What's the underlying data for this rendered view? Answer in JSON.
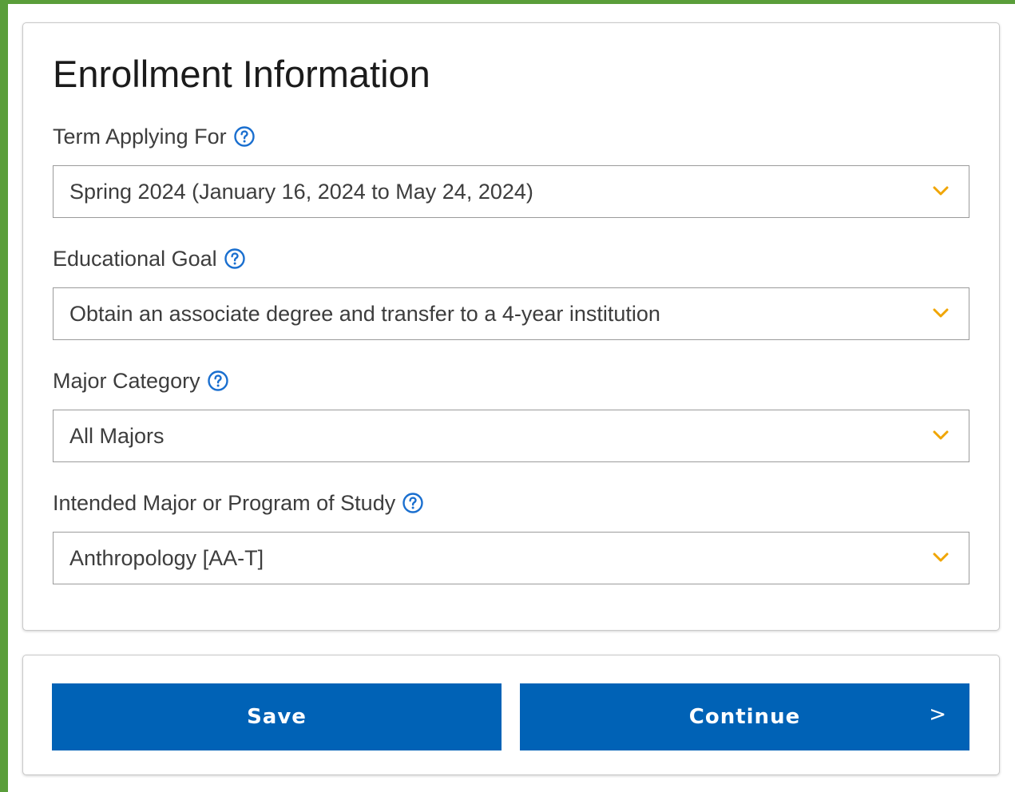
{
  "form": {
    "title": "Enrollment Information",
    "fields": [
      {
        "label": "Term Applying For",
        "value": "Spring 2024 (January 16, 2024 to May 24, 2024)"
      },
      {
        "label": "Educational Goal",
        "value": "Obtain an associate degree and transfer to a 4-year institution"
      },
      {
        "label": "Major Category",
        "value": "All Majors"
      },
      {
        "label": "Intended Major or Program of Study",
        "value": "Anthropology [AA-T]"
      }
    ]
  },
  "actions": {
    "save_label": "Save",
    "continue_label": "Continue",
    "continue_arrow": ">"
  },
  "icons": {
    "help": "question-circle-icon",
    "dropdown": "chevron-down-icon"
  },
  "colors": {
    "frame": "#5a9e3a",
    "primary_button": "#0062b6",
    "help_icon": "#1a6fcf",
    "chevron": "#f0a500",
    "text": "#3d3d3d"
  }
}
